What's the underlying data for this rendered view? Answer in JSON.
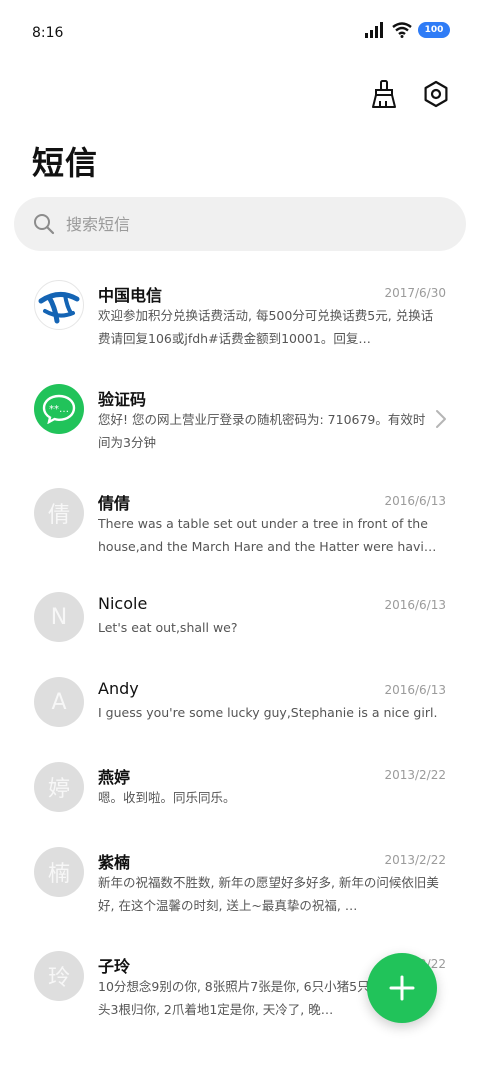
{
  "status_bar": {
    "time": "8:16",
    "battery_level": "100"
  },
  "header": {
    "title": "短信"
  },
  "search": {
    "placeholder": "搜索短信"
  },
  "messages": [
    {
      "name": "中国电信",
      "date": "2017/6/30",
      "preview": "欢迎参加积分兑换话费活动, 每500分可兑换话费5元, 兑换话费请回复106或jfdh#话费金额到10001。回复…",
      "avatar": "china-telecom-logo"
    },
    {
      "name": "验证码",
      "date": "",
      "preview": "您好! 您の网上营业厅登录の随机密码为: 710679。有效时间为3分钟",
      "avatar": "sms-bubble-icon"
    },
    {
      "name": "倩倩",
      "date": "2016/6/13",
      "preview": "There was a table set out under a tree in front of the house,and the March Hare and the Hatter were having te…",
      "avatar_letter": "倩"
    },
    {
      "name": "Nicole",
      "date": "2016/6/13",
      "preview": "Let's eat out,shall we?",
      "avatar_letter": "N"
    },
    {
      "name": "Andy",
      "date": "2016/6/13",
      "preview": "I guess you're some lucky guy,Stephanie is a nice girl.",
      "avatar_letter": "A"
    },
    {
      "name": "燕婷",
      "date": "2013/2/22",
      "preview": "嗯。收到啦。同乐同乐。",
      "avatar_letter": "婷"
    },
    {
      "name": "紫楠",
      "date": "2013/2/22",
      "preview": "新年の祝福数不胜数, 新年の愿望好多好多, 新年の问候依旧美好, 在这个温馨の时刻, 送上~最真挚の祝福, …",
      "avatar_letter": "楠"
    },
    {
      "name": "子玲",
      "date": "2013/2/22",
      "preview": "10分想念9别の你, 8张照片7张是你, 6只小猪5只像你, 4根骨头3根归你, 2爪着地1定是你, 天冷了, 晚…",
      "avatar_letter": "玲"
    }
  ],
  "colors": {
    "accent": "#21c35a",
    "telecom_blue": "#1464b4",
    "battery": "#2f7cf6"
  },
  "icons": {
    "clean": "broom-icon",
    "settings": "hexagon-gear-icon",
    "fab": "plus-icon"
  }
}
